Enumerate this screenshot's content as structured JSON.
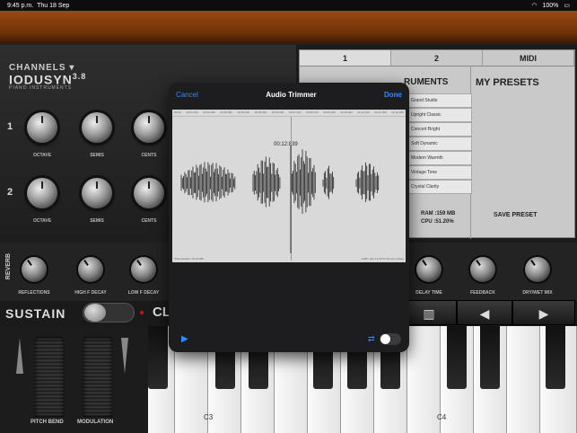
{
  "status": {
    "time": "9:45 p.m.",
    "date": "Thu 18 Sep",
    "battery": "100%"
  },
  "channels_label": "CHANNELS",
  "logo": {
    "name": "IODUSYN",
    "version": "3.8",
    "sub": "PIANO INSTRUMENTS"
  },
  "knobs": {
    "row1": {
      "num": "1",
      "labels": [
        "OCTAVE",
        "SEMIS",
        "CENTS"
      ]
    },
    "row2": {
      "num": "2",
      "labels": [
        "OCTAVE",
        "SEMIS",
        "CENTS"
      ]
    }
  },
  "tabs": [
    "1",
    "2",
    "MIDI"
  ],
  "instruments_title": "RUMENTS",
  "presets_title": "MY PRESETS",
  "instruments": [
    "Grand Studio",
    "Upright Classic",
    "Concert Bright",
    "Soft Dynamic",
    "Modern Warmth",
    "Vintage Tone",
    "Crystal Clarity"
  ],
  "ram": "RAM :159 MB",
  "cpu": "CPU :51.20%",
  "save_preset": "SAVE PRESET",
  "reverb_label": "REVERB",
  "reverb_knobs": [
    "REFLECTIONS",
    "HIGH F DECAY",
    "LOW F DECAY"
  ],
  "delay_knobs": [
    "DELAY TIME",
    "FEEDBACK",
    "DRY/WET MIX"
  ],
  "sustain": "SUSTAIN",
  "sustain_next": "CL",
  "controls": {
    "keys_icon": "piano-keys-icon",
    "prev": "◀",
    "next": "▶"
  },
  "wheels": {
    "pitch": "PITCH BEND",
    "mod": "MODULATION"
  },
  "keys": {
    "c3": "C3",
    "c4": "C4"
  },
  "modal": {
    "cancel": "Cancel",
    "title": "Audio Trimmer",
    "done": "Done",
    "timecode": "00:12:839",
    "total": "Total duration: 00:22:839",
    "info": "C280 .wav 13.18.57.20 mins (Note)",
    "ruler": [
      "00:00",
      "00:01.000",
      "00:02.000",
      "00:03.000",
      "00:04.000",
      "00:05.000",
      "00:06.000",
      "00:07.000",
      "00:08.000",
      "00:09.000",
      "00:10.000",
      "00:11.000",
      "00:12.000",
      "00:13.000",
      "00:14.000",
      "00:15.000",
      "00:16.000",
      "00:17.000",
      "00:18.000"
    ]
  },
  "colors": {
    "accent": "#2b8cff",
    "wood": "#8a420f"
  }
}
